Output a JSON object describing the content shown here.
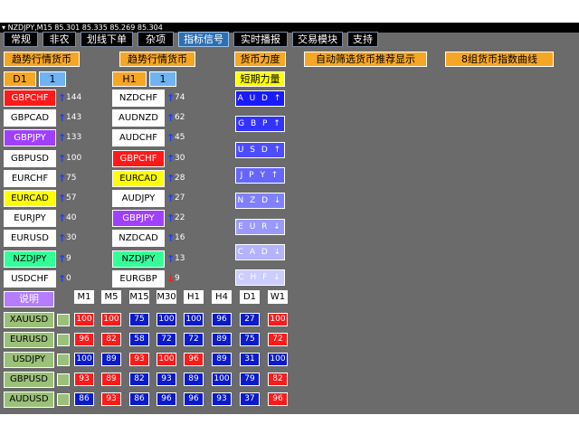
{
  "title": "NZDJPY,M15  85.301 85.335 85.269 85.304",
  "toolbar": [
    {
      "label": "常规",
      "active": false
    },
    {
      "label": "非农",
      "active": false
    },
    {
      "label": "划线下单",
      "active": false
    },
    {
      "label": "杂项",
      "active": false
    },
    {
      "label": "指标信号",
      "active": true
    },
    {
      "label": "实时播报",
      "active": false
    },
    {
      "label": "交易模块",
      "active": false
    },
    {
      "label": "支持",
      "active": false
    }
  ],
  "headers": {
    "trend1": "趋势行情货币",
    "trend2": "趋势行情货币",
    "strength": "货币力度",
    "auto": "自动筛选货币推荐显示",
    "index": "8组货币指数曲线",
    "short": "短期力量"
  },
  "tf1": {
    "label": "D1",
    "value": "1"
  },
  "tf2": {
    "label": "H1",
    "value": "1"
  },
  "list1": [
    {
      "sym": "GBPCHF",
      "bg": "#ff1a1a",
      "fg": "#ffffff",
      "dir": "up",
      "score": "144"
    },
    {
      "sym": "GBPCAD",
      "bg": "#ffffff",
      "fg": "#000000",
      "dir": "up",
      "score": "143"
    },
    {
      "sym": "GBPJPY",
      "bg": "#a040ff",
      "fg": "#ffffff",
      "dir": "up",
      "score": "133"
    },
    {
      "sym": "GBPUSD",
      "bg": "#ffffff",
      "fg": "#000000",
      "dir": "up",
      "score": "100"
    },
    {
      "sym": "EURCHF",
      "bg": "#ffffff",
      "fg": "#000000",
      "dir": "up",
      "score": "75"
    },
    {
      "sym": "EURCAD",
      "bg": "#ffff00",
      "fg": "#000000",
      "dir": "up",
      "score": "57"
    },
    {
      "sym": "EURJPY",
      "bg": "#ffffff",
      "fg": "#000000",
      "dir": "up",
      "score": "40"
    },
    {
      "sym": "EURUSD",
      "bg": "#ffffff",
      "fg": "#000000",
      "dir": "up",
      "score": "30"
    },
    {
      "sym": "NZDJPY",
      "bg": "#33ff99",
      "fg": "#000000",
      "dir": "up",
      "score": "9"
    },
    {
      "sym": "USDCHF",
      "bg": "#ffffff",
      "fg": "#000000",
      "dir": "up",
      "score": "0"
    }
  ],
  "list2": [
    {
      "sym": "NZDCHF",
      "bg": "#ffffff",
      "fg": "#000000",
      "dir": "up",
      "score": "74"
    },
    {
      "sym": "AUDNZD",
      "bg": "#ffffff",
      "fg": "#000000",
      "dir": "up",
      "score": "62"
    },
    {
      "sym": "AUDCHF",
      "bg": "#ffffff",
      "fg": "#000000",
      "dir": "up",
      "score": "45"
    },
    {
      "sym": "GBPCHF",
      "bg": "#ff1a1a",
      "fg": "#ffffff",
      "dir": "up",
      "score": "30"
    },
    {
      "sym": "EURCAD",
      "bg": "#ffff00",
      "fg": "#000000",
      "dir": "up",
      "score": "28"
    },
    {
      "sym": "AUDJPY",
      "bg": "#ffffff",
      "fg": "#000000",
      "dir": "up",
      "score": "27"
    },
    {
      "sym": "GBPJPY",
      "bg": "#a040ff",
      "fg": "#ffffff",
      "dir": "up",
      "score": "22"
    },
    {
      "sym": "NZDCAD",
      "bg": "#ffffff",
      "fg": "#000000",
      "dir": "up",
      "score": "16"
    },
    {
      "sym": "NZDJPY",
      "bg": "#33ff99",
      "fg": "#000000",
      "dir": "up",
      "score": "13"
    },
    {
      "sym": "EURGBP",
      "bg": "#ffffff",
      "fg": "#000000",
      "dir": "down",
      "score": "9"
    }
  ],
  "currencies": [
    {
      "label": "A U D ↑",
      "bg": "#1a1aff"
    },
    {
      "label": "G B P ↑",
      "bg": "#3333ff"
    },
    {
      "label": "U S D ↑",
      "bg": "#4d4dff"
    },
    {
      "label": "J P Y ↑",
      "bg": "#6666ff"
    },
    {
      "label": "N Z D ↓",
      "bg": "#8080ff"
    },
    {
      "label": "E U R ↓",
      "bg": "#9999ff"
    },
    {
      "label": "C A D ↓",
      "bg": "#b3b3ff"
    },
    {
      "label": "C H F ↓",
      "bg": "#ccccff"
    }
  ],
  "explain": "说明",
  "timeframes": [
    "M1",
    "M5",
    "M15",
    "M30",
    "H1",
    "H4",
    "D1",
    "W1"
  ],
  "matrix": [
    {
      "pair": "XAUUSD",
      "cells": [
        {
          "v": "100",
          "c": "r"
        },
        {
          "v": "100",
          "c": "r"
        },
        {
          "v": "75",
          "c": "b"
        },
        {
          "v": "100",
          "c": "b"
        },
        {
          "v": "100",
          "c": "b"
        },
        {
          "v": "96",
          "c": "b"
        },
        {
          "v": "27",
          "c": "b"
        },
        {
          "v": "100",
          "c": "r"
        }
      ]
    },
    {
      "pair": "EURUSD",
      "cells": [
        {
          "v": "96",
          "c": "r"
        },
        {
          "v": "82",
          "c": "r"
        },
        {
          "v": "58",
          "c": "b"
        },
        {
          "v": "72",
          "c": "b"
        },
        {
          "v": "72",
          "c": "b"
        },
        {
          "v": "89",
          "c": "b"
        },
        {
          "v": "75",
          "c": "b"
        },
        {
          "v": "72",
          "c": "r"
        }
      ]
    },
    {
      "pair": "USDJPY",
      "cells": [
        {
          "v": "100",
          "c": "b"
        },
        {
          "v": "89",
          "c": "b"
        },
        {
          "v": "93",
          "c": "r"
        },
        {
          "v": "100",
          "c": "r"
        },
        {
          "v": "96",
          "c": "r"
        },
        {
          "v": "89",
          "c": "b"
        },
        {
          "v": "31",
          "c": "b"
        },
        {
          "v": "100",
          "c": "b"
        }
      ]
    },
    {
      "pair": "GBPUSD",
      "cells": [
        {
          "v": "93",
          "c": "r"
        },
        {
          "v": "89",
          "c": "r"
        },
        {
          "v": "82",
          "c": "b"
        },
        {
          "v": "93",
          "c": "b"
        },
        {
          "v": "89",
          "c": "b"
        },
        {
          "v": "100",
          "c": "b"
        },
        {
          "v": "79",
          "c": "b"
        },
        {
          "v": "82",
          "c": "r"
        }
      ]
    },
    {
      "pair": "AUDUSD",
      "cells": [
        {
          "v": "86",
          "c": "b"
        },
        {
          "v": "93",
          "c": "r"
        },
        {
          "v": "86",
          "c": "b"
        },
        {
          "v": "96",
          "c": "b"
        },
        {
          "v": "96",
          "c": "b"
        },
        {
          "v": "93",
          "c": "b"
        },
        {
          "v": "37",
          "c": "b"
        },
        {
          "v": "96",
          "c": "r"
        }
      ]
    }
  ]
}
